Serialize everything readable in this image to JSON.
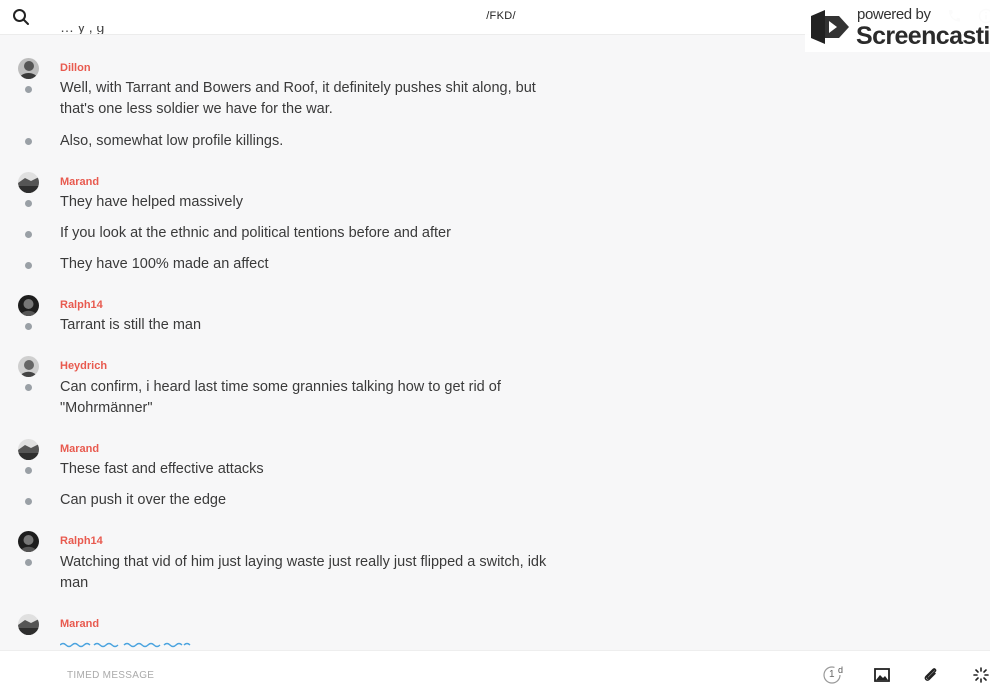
{
  "header": {
    "title": "/FKD/"
  },
  "watermark": {
    "line1": "powered by",
    "line2": "Screencastify"
  },
  "chat": {
    "cut_off_text": "…                                                    y             ,           g",
    "groups": [
      {
        "sender": "Dillon",
        "messages": [
          "Well, with Tarrant and Bowers and Roof, it definitely pushes shit along, but that's one less soldier we have for the war.",
          "Also, somewhat low profile killings."
        ]
      },
      {
        "sender": "Marand",
        "messages": [
          "They have helped massively",
          "If you look at the ethnic and political tentions before and after",
          "They have 100% made an affect"
        ]
      },
      {
        "sender": "Ralph14",
        "messages": [
          "Tarrant is still the man"
        ]
      },
      {
        "sender": "Heydrich",
        "messages": [
          "Can confirm, i heard last time some grannies talking how to get rid of \"Mohrmänner\""
        ]
      },
      {
        "sender": "Marand",
        "messages": [
          "These fast and effective attacks",
          "Can push it over the edge"
        ]
      },
      {
        "sender": "Ralph14",
        "messages": [
          "Watching that vid of him just laying waste just really just flipped a switch, idk man"
        ]
      },
      {
        "sender": "Marand",
        "messages": []
      }
    ]
  },
  "composer": {
    "placeholder": "TIMED MESSAGE",
    "timer_value": "1",
    "timer_unit": "d"
  },
  "colors": {
    "sender": "#e85a4f",
    "background": "#f7f7f8"
  }
}
